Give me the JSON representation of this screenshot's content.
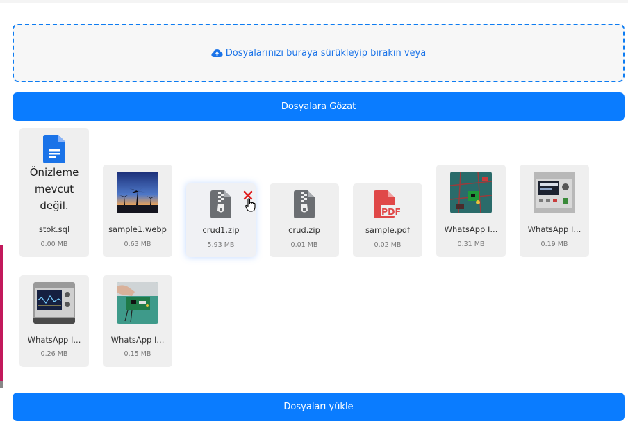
{
  "dropzone": {
    "text": "Dosyalarınızı buraya sürükleyip bırakın veya",
    "icon": "cloud-upload-icon"
  },
  "browse_button": {
    "label": "Dosyalara Gözat"
  },
  "upload_button": {
    "label": "Dosyaları yükle"
  },
  "colors": {
    "accent": "#0a7cff",
    "dropzone_border": "#0d7cf2",
    "pdf_red": "#e04848",
    "doc_blue": "#1a73e8",
    "zip_gray": "#6b6e72",
    "remove_red": "#e02020"
  },
  "files": [
    {
      "name": "stok.sql",
      "size": "0.00 MB",
      "icon": "google-doc-icon",
      "preview_text": "Önizleme mevcut değil."
    },
    {
      "name": "sample1.webp",
      "size": "0.63 MB",
      "icon": "image-thumbnail"
    },
    {
      "name": "crud1.zip",
      "size": "5.93 MB",
      "icon": "zip-file-icon"
    },
    {
      "name": "crud.zip",
      "size": "0.01 MB",
      "icon": "zip-file-icon"
    },
    {
      "name": "sample.pdf",
      "size": "0.02 MB",
      "icon": "pdf-file-icon"
    },
    {
      "name": "WhatsApp I...",
      "size": "0.31 MB",
      "icon": "image-thumbnail"
    },
    {
      "name": "WhatsApp I...",
      "size": "0.19 MB",
      "icon": "image-thumbnail"
    },
    {
      "name": "WhatsApp I...",
      "size": "0.26 MB",
      "icon": "image-thumbnail"
    },
    {
      "name": "WhatsApp I...",
      "size": "0.15 MB",
      "icon": "image-thumbnail"
    }
  ]
}
